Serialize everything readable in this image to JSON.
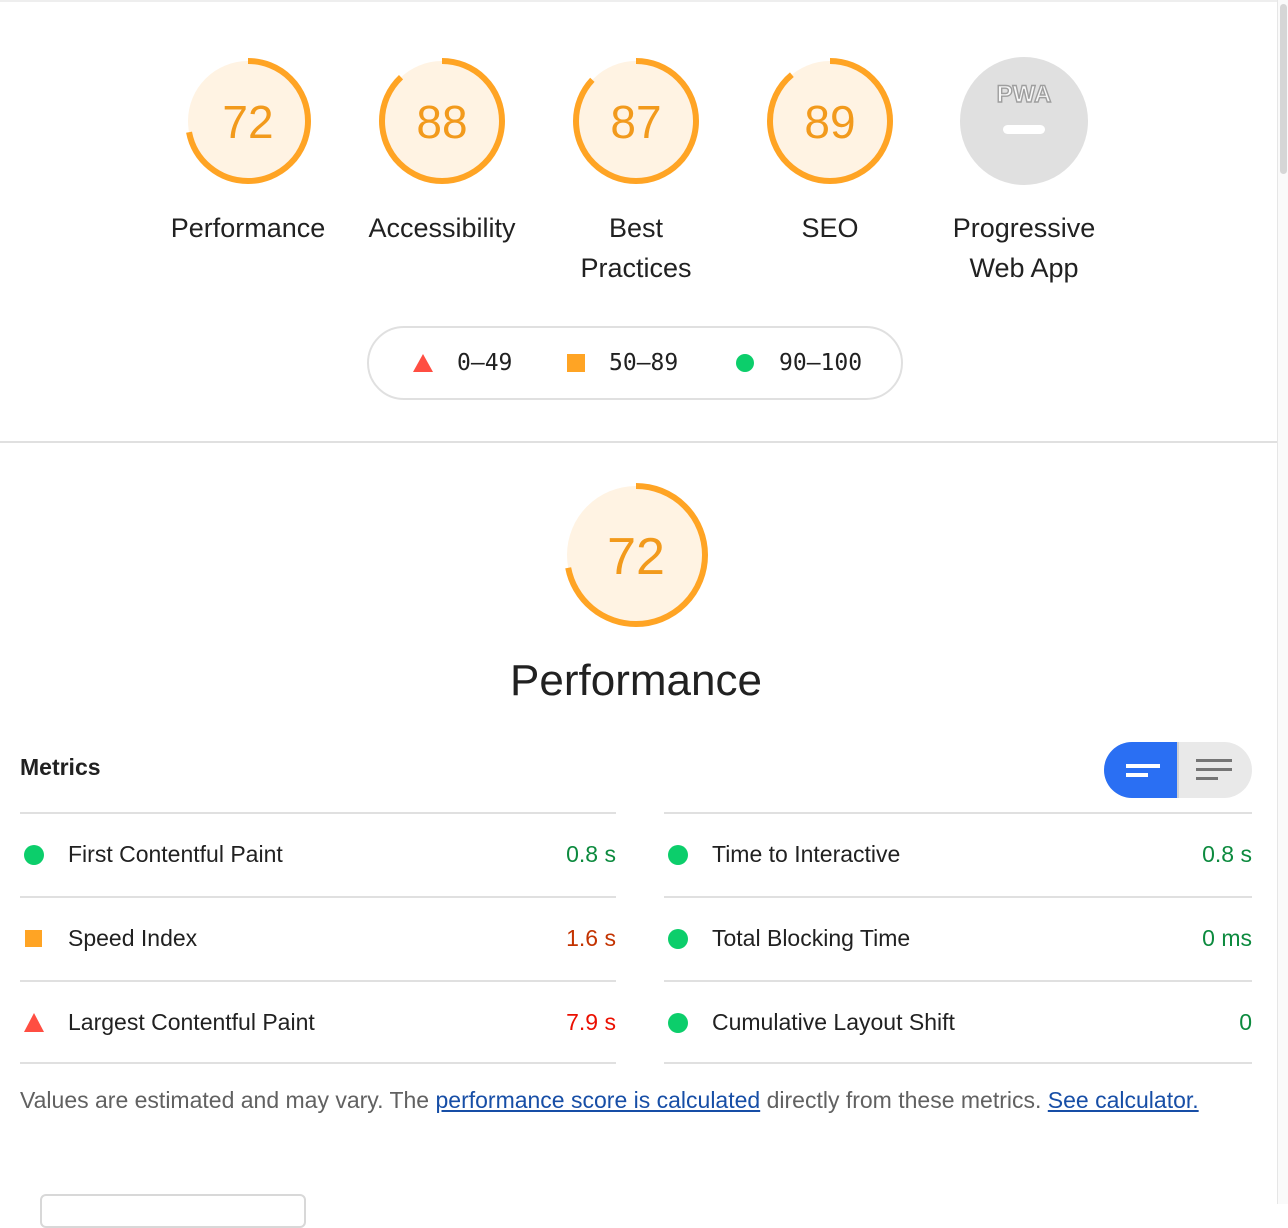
{
  "categories": [
    {
      "score": "72",
      "label": "Performance",
      "fraction": 0.72
    },
    {
      "score": "88",
      "label": "Accessibility",
      "fraction": 0.88
    },
    {
      "score": "87",
      "label": "Best Practices",
      "fraction": 0.87
    },
    {
      "score": "89",
      "label": "SEO",
      "fraction": 0.89
    }
  ],
  "pwa": {
    "badge": "PWA",
    "label": "Progressive Web App"
  },
  "legend": {
    "fail": "0–49",
    "average": "50–89",
    "pass": "90–100"
  },
  "performance": {
    "score": "72",
    "title": "Performance",
    "fraction": 0.72
  },
  "metrics": {
    "title": "Metrics",
    "left": [
      {
        "name": "First Contentful Paint",
        "value": "0.8 s",
        "rating": "pass"
      },
      {
        "name": "Speed Index",
        "value": "1.6 s",
        "rating": "average"
      },
      {
        "name": "Largest Contentful Paint",
        "value": "7.9 s",
        "rating": "fail"
      }
    ],
    "right": [
      {
        "name": "Time to Interactive",
        "value": "0.8 s",
        "rating": "pass"
      },
      {
        "name": "Total Blocking Time",
        "value": "0 ms",
        "rating": "pass"
      },
      {
        "name": "Cumulative Layout Shift",
        "value": "0",
        "rating": "pass"
      }
    ]
  },
  "note": {
    "prefix": "Values are estimated and may vary. The ",
    "link1": "performance score is calculated",
    "middle": " directly from these metrics. ",
    "link2": "See calculator."
  },
  "colors": {
    "average": "#ffa424",
    "average_bg": "#fff3e3",
    "pass": "#0cce6b",
    "fail": "#ff4e42",
    "toggle_active": "#2a6ff3",
    "pwa_gray": "#e0e0e0"
  }
}
